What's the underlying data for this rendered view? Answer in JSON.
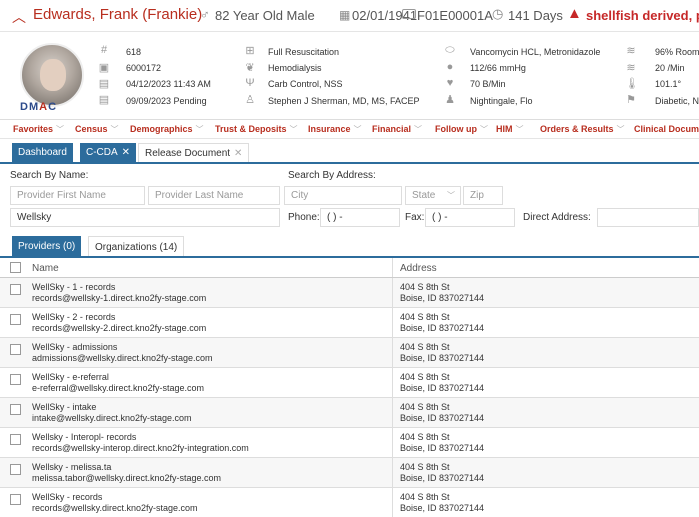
{
  "patient": {
    "name": "Edwards, Frank (Frankie)",
    "age_gender": "82 Year Old Male",
    "dob": "02/01/1941",
    "mrn": "F01E00001A",
    "days": "141 Days",
    "allergy": "shellfish derived, polle",
    "logo_prefix": "DM",
    "logo_a": "A",
    "logo_suffix": "C",
    "col1": [
      "618",
      "6000172",
      "04/12/2023 11:43 AM",
      "09/09/2023 Pending"
    ],
    "col2": [
      "Full Resuscitation",
      "Hemodialysis",
      "Carb Control, NSS",
      "Stephen J Sherman, MD, MS, FACEP"
    ],
    "col3": [
      "Vancomycin HCL, Metronidazole",
      "112/66 mmHg",
      "70 B/Min",
      "Nightingale, Flo"
    ],
    "col4": [
      "96% Room",
      "20 /Min",
      "101.1°",
      "Diabetic, N"
    ]
  },
  "nav": [
    "Favorites",
    "Census",
    "Demographics",
    "Trust & Deposits",
    "Insurance",
    "Financial",
    "Follow up",
    "HIM",
    "Orders & Results",
    "Clinical Docume"
  ],
  "tabs": {
    "dashboard": "Dashboard",
    "ccda": "C-CDA",
    "release": "Release Document",
    "close": "✕"
  },
  "search": {
    "by_name_label": "Search By Name:",
    "by_address_label": "Search By Address:",
    "first_name_placeholder": "Provider First Name",
    "last_name_placeholder": "Provider Last Name",
    "city_placeholder": "City",
    "state_placeholder": "State",
    "zip_placeholder": "Zip",
    "org_value": "Wellsky",
    "phone_label": "Phone:",
    "phone_value": "(  )   -",
    "fax_label": "Fax:",
    "fax_value": "(  )   -",
    "direct_label": "Direct Address:"
  },
  "subtabs": {
    "providers": "Providers (0)",
    "organizations": "Organizations (14)"
  },
  "table": {
    "col_name": "Name",
    "col_address": "Address",
    "rows": [
      {
        "name": "WellSky - 1 - records",
        "email": "records@wellsky-1.direct.kno2fy-stage.com",
        "addr1": "404 S 8th St",
        "addr2": "Boise, ID 837027144"
      },
      {
        "name": "WellSky - 2 - records",
        "email": "records@wellsky-2.direct.kno2fy-stage.com",
        "addr1": "404 S 8th St",
        "addr2": "Boise, ID 837027144"
      },
      {
        "name": "WellSky - admissions",
        "email": "admissions@wellsky.direct.kno2fy-stage.com",
        "addr1": "404 S 8th St",
        "addr2": "Boise, ID 837027144"
      },
      {
        "name": "WellSky - e-referral",
        "email": "e-referral@wellsky.direct.kno2fy-stage.com",
        "addr1": "404 S 8th St",
        "addr2": "Boise, ID 837027144"
      },
      {
        "name": "WellSky - intake",
        "email": "intake@wellsky.direct.kno2fy-stage.com",
        "addr1": "404 S 8th St",
        "addr2": "Boise, ID 837027144"
      },
      {
        "name": "Wellsky - Interopl- records",
        "email": "records@wellsky-interop.direct.kno2fy-integration.com",
        "addr1": "404 S 8th St",
        "addr2": "Boise, ID 837027144"
      },
      {
        "name": "Wellsky - melissa.ta",
        "email": "melissa.tabor@wellsky.direct.kno2fy-stage.com",
        "addr1": "404 S 8th St",
        "addr2": "Boise, ID 837027144"
      },
      {
        "name": "WellSky - records",
        "email": "records@wellsky.direct.kno2fy-stage.com",
        "addr1": "404 S 8th St",
        "addr2": "Boise, ID 837027144"
      }
    ]
  },
  "colors": {
    "brand_red": "#b82e1f",
    "tab_blue": "#2c6c9c",
    "allergy_red": "#c62828"
  }
}
